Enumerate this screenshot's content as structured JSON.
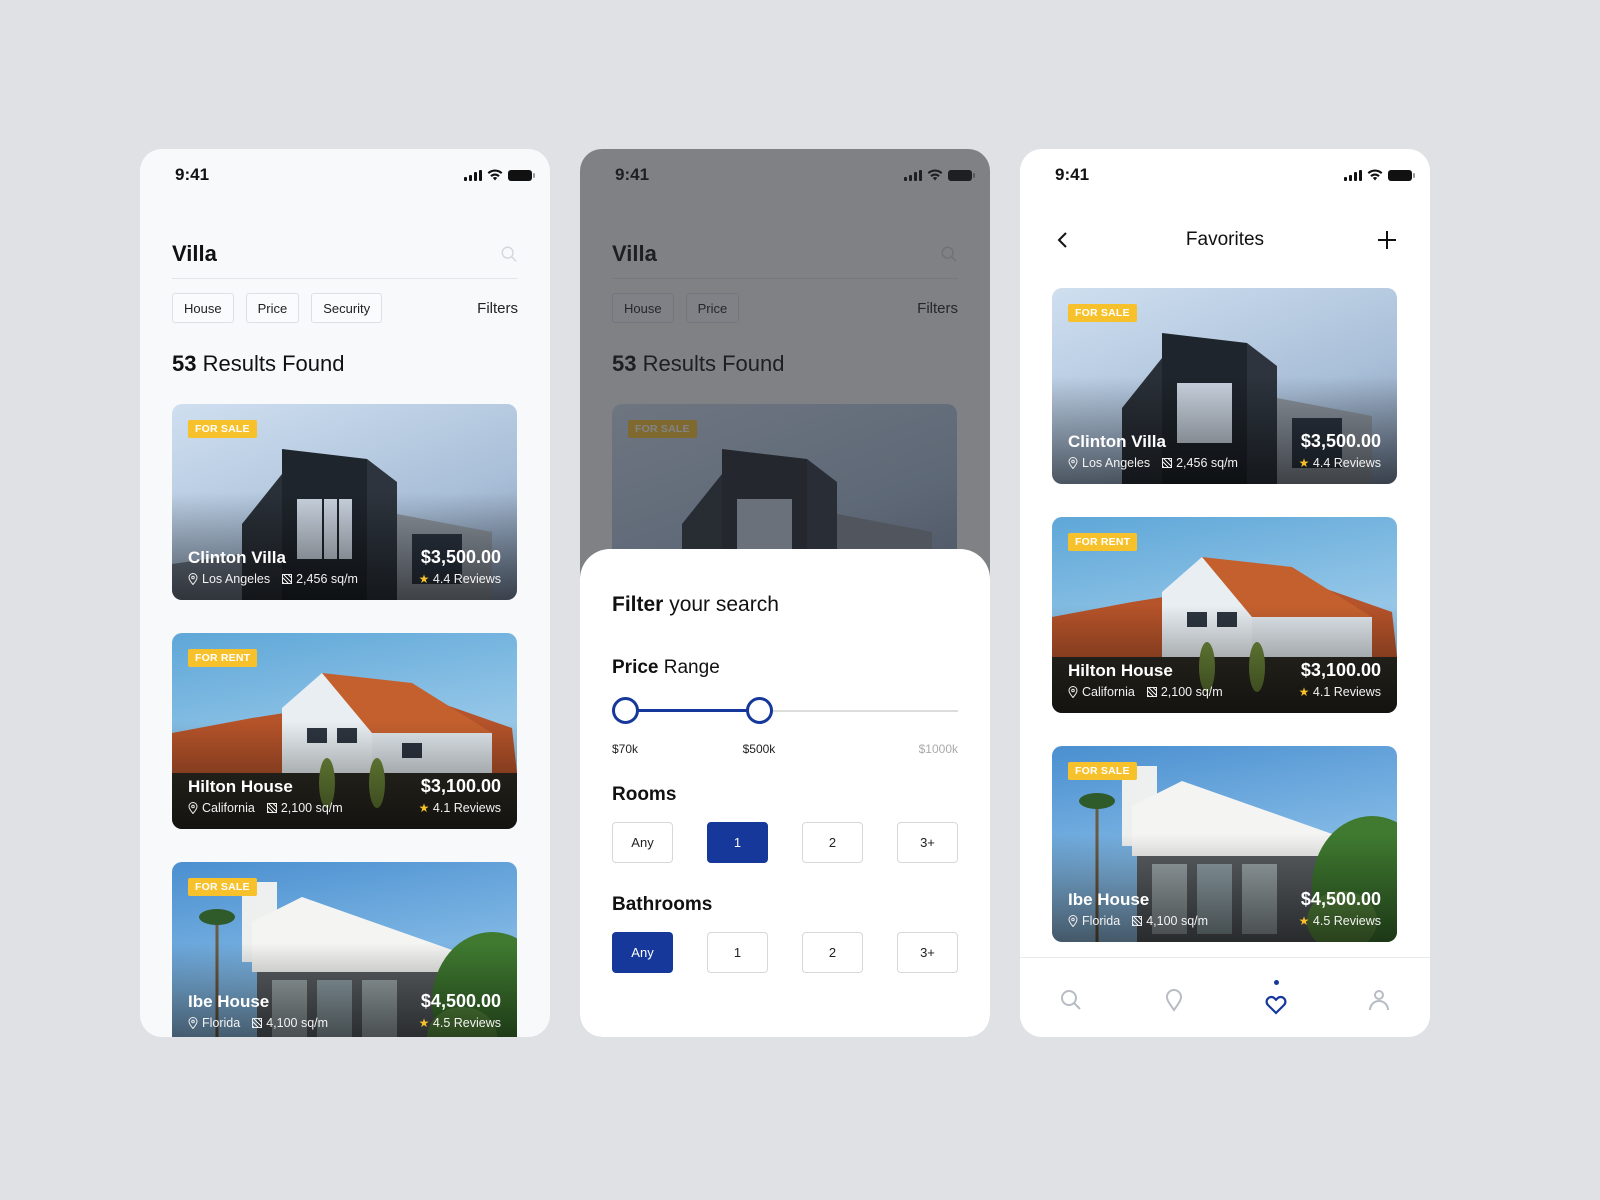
{
  "status_bar": {
    "time": "9:41"
  },
  "search_screen": {
    "query": "Villa",
    "chips": [
      "House",
      "Price",
      "Security"
    ],
    "filters_label": "Filters",
    "results_count": "53",
    "results_label": "Results Found"
  },
  "filter_screen": {
    "chips": [
      "House",
      "Price"
    ],
    "filters_label": "Filters",
    "sheet_title_bold": "Filter",
    "sheet_title_rest": "your search",
    "price_range": {
      "label_bold": "Price",
      "label_rest": "Range",
      "min_label": "$70k",
      "max_selected_label": "$500k",
      "range_max_label": "$1000k",
      "min_value_k": 70,
      "selected_max_k": 500,
      "scale_max_k": 1000
    },
    "rooms": {
      "label": "Rooms",
      "options": [
        "Any",
        "1",
        "2",
        "3+"
      ],
      "selected": "1"
    },
    "bathrooms": {
      "label": "Bathrooms",
      "options": [
        "Any",
        "1",
        "2",
        "3+"
      ],
      "selected": "Any"
    }
  },
  "favorites_screen": {
    "title": "Favorites",
    "back_icon": "chevron-left-icon",
    "add_icon": "plus-icon",
    "tabbar": [
      {
        "name": "search",
        "icon": "search-icon",
        "active": false
      },
      {
        "name": "map",
        "icon": "map-pin-icon",
        "active": false
      },
      {
        "name": "favorites",
        "icon": "heart-icon",
        "active": true
      },
      {
        "name": "profile",
        "icon": "user-icon",
        "active": false
      }
    ]
  },
  "listings": [
    {
      "badge": "FOR SALE",
      "name": "Clinton Villa",
      "price": "$3,500.00",
      "location": "Los Angeles",
      "area": "2,456 sq/m",
      "reviews": "4.4 Reviews"
    },
    {
      "badge": "FOR RENT",
      "name": "Hilton House",
      "price": "$3,100.00",
      "location": "California",
      "area": "2,100 sq/m",
      "reviews": "4.1 Reviews"
    },
    {
      "badge": "FOR SALE",
      "name": "Ibe House",
      "price": "$4,500.00",
      "location": "Florida",
      "area": "4,100 sq/m",
      "reviews": "4.5 Reviews"
    }
  ],
  "colors": {
    "accent": "#15389a",
    "badge": "#f7c12c",
    "background": "#dfe1e5"
  }
}
